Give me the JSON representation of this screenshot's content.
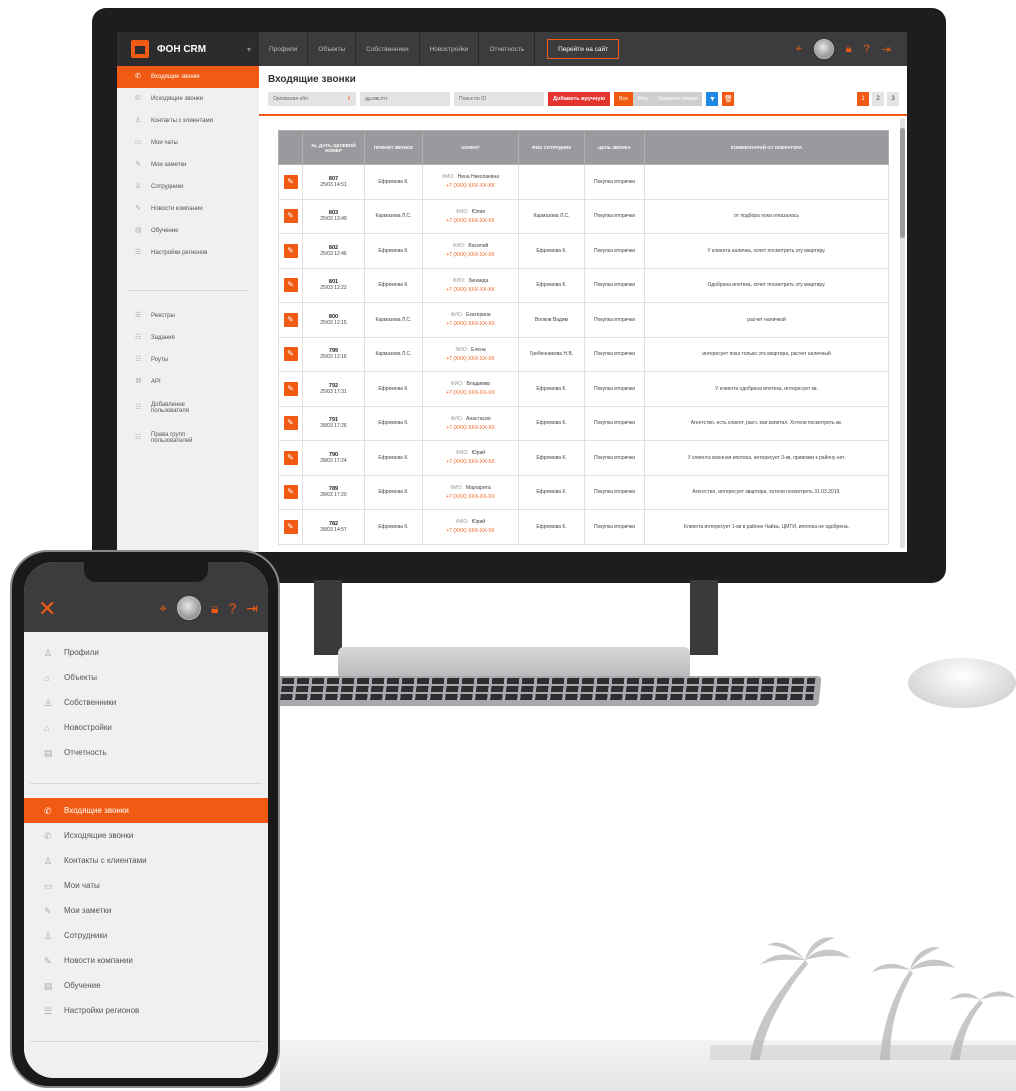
{
  "app": {
    "brand": "ФОН CRM",
    "nav_tabs": [
      "Профили",
      "Объекты",
      "Собственники",
      "Новостройки",
      "Отчетность"
    ],
    "site_button": "Перейти на сайт"
  },
  "sidebar": {
    "items": [
      {
        "label": "Входящие звонки",
        "active": true
      },
      {
        "label": "Исходящие звонки"
      },
      {
        "label": "Контакты с клиентами"
      },
      {
        "label": "Мои чаты"
      },
      {
        "label": "Мои заметки"
      },
      {
        "label": "Сотрудники"
      },
      {
        "label": "Новости компании"
      },
      {
        "label": "Обучение"
      },
      {
        "label": "Настройки регионов"
      }
    ],
    "items2": [
      {
        "label": "Реестры"
      },
      {
        "label": "Задания"
      },
      {
        "label": "Роуты"
      },
      {
        "label": "API"
      },
      {
        "label": "Добавление пользователя"
      },
      {
        "label": "Права групп пользователей"
      }
    ]
  },
  "main": {
    "title": "Входящие звонки",
    "filters": {
      "region": "Орловская обл",
      "date": "дд.мм.гггг",
      "search": "Поиск по ID",
      "add_button": "Добавить вручную",
      "seg_all": "Все",
      "seg_mine": "Мои",
      "seg_closed": "Закрытые звонки"
    },
    "pages": [
      "1",
      "2",
      "3"
    ],
    "columns": [
      "",
      "№, дата, целевой номер",
      "Принял звонок",
      "Клиент",
      "ФИО сотрудник",
      "Цель звонка",
      "Комментарий от оператора"
    ],
    "rows": [
      {
        "id": "807",
        "date": "25/03 14:51",
        "accepted": "Ефремова К.",
        "client": "Нина Николаевна",
        "phone": "+7 (XXX) XXX-XX-XX",
        "employee": "",
        "goal": "Покупка вторички",
        "comment": ""
      },
      {
        "id": "803",
        "date": "25/03 13:49",
        "accepted": "Кармазова Л.С.",
        "client": "Юлия",
        "phone": "+7 (XXX) XXX-XX-XX",
        "employee": "Кармазова Л.С.",
        "goal": "Покупка вторички",
        "comment": "от подбора пока отказалась"
      },
      {
        "id": "802",
        "date": "25/03 12:46",
        "accepted": "Ефремова К.",
        "client": "Василий",
        "phone": "+7 (XXX) XXX-XX-XX",
        "employee": "Ефремова К.",
        "goal": "Покупка вторички",
        "comment": "У клиента наличка, хочет посмотреть эту квартиру."
      },
      {
        "id": "801",
        "date": "25/03 12:22",
        "accepted": "Ефремова К.",
        "client": "Зинаида",
        "phone": "+7 (XXX) XXX-XX-XX",
        "employee": "Ефремова К.",
        "goal": "Покупка вторички",
        "comment": "Одобрена ипотека, хочет посмотреть эту квартиру."
      },
      {
        "id": "800",
        "date": "25/03 12:15",
        "accepted": "Кармазова Л.С.",
        "client": "Екатерина",
        "phone": "+7 (XXX) XXX-XX-XX",
        "employee": "Волков Вадим",
        "goal": "Покупка вторички",
        "comment": "расчет наличкой"
      },
      {
        "id": "799",
        "date": "25/03 12:16",
        "accepted": "Кармазова Л.С.",
        "client": "Елена",
        "phone": "+7 (XXX) XXX-XX-XX",
        "employee": "Гребенникова Н.В.",
        "goal": "Покупка вторички",
        "comment": "интересует пока только эта квартира, расчет наличный"
      },
      {
        "id": "792",
        "date": "25/03 17:31",
        "accepted": "Ефремова К.",
        "client": "Владимир",
        "phone": "+7 (XXX) XXX-XX-XX",
        "employee": "Ефремова К.",
        "goal": "Покупка вторички",
        "comment": "У клиента одобрена ипотека, интересует кв."
      },
      {
        "id": "791",
        "date": "28/03 17:26",
        "accepted": "Ефремова К.",
        "client": "Анастасия",
        "phone": "+7 (XXX) XXX-XX-XX",
        "employee": "Ефремова К.",
        "goal": "Покупка вторички",
        "comment": "Агентство, есть клиент, расч. мат.капитал. Хотели посмотреть кв."
      },
      {
        "id": "790",
        "date": "28/03 17:24",
        "accepted": "Ефремова К.",
        "client": "Юрий",
        "phone": "+7 (XXX) XXX-XX-XX",
        "employee": "Ефремова К.",
        "goal": "Покупка вторички",
        "comment": "У клиента военная ипотека, интересует 3-кв, привязки к району нет."
      },
      {
        "id": "789",
        "date": "28/03 17:20",
        "accepted": "Ефремова К.",
        "client": "Маргарита",
        "phone": "+7 (XXX) XXX-XX-XX",
        "employee": "Ефремова К.",
        "goal": "Покупка вторички",
        "comment": "Агентство, интересует квартира, хотели посмотреть 31.03.2019."
      },
      {
        "id": "782",
        "date": "28/03 14:57",
        "accepted": "Ефремова К.",
        "client": "Юрий",
        "phone": "+7 (XXX) XXX-XX-XX",
        "employee": "Ефремова К.",
        "goal": "Покупка вторички",
        "comment": "Клиента интересует 1-кв в районе Чайка, ЦМТИ, ипотека не одобрена."
      }
    ]
  },
  "phone": {
    "menu_top": [
      "Профили",
      "Объекты",
      "Собственники",
      "Новостройки",
      "Отчетность"
    ],
    "menu_bottom": [
      {
        "label": "Входящие звонки",
        "active": true
      },
      {
        "label": "Исходящие звонки"
      },
      {
        "label": "Контакты с клиентами"
      },
      {
        "label": "Мои чаты"
      },
      {
        "label": "Мои заметки"
      },
      {
        "label": "Сотрудники"
      },
      {
        "label": "Новости компании"
      },
      {
        "label": "Обучение"
      },
      {
        "label": "Настройки регионов"
      }
    ]
  },
  "colors": {
    "accent": "#f05a12",
    "topbar": "#3c3c3e",
    "sidebar": "#f0f0f2",
    "header_cell": "#9a9a9e"
  }
}
